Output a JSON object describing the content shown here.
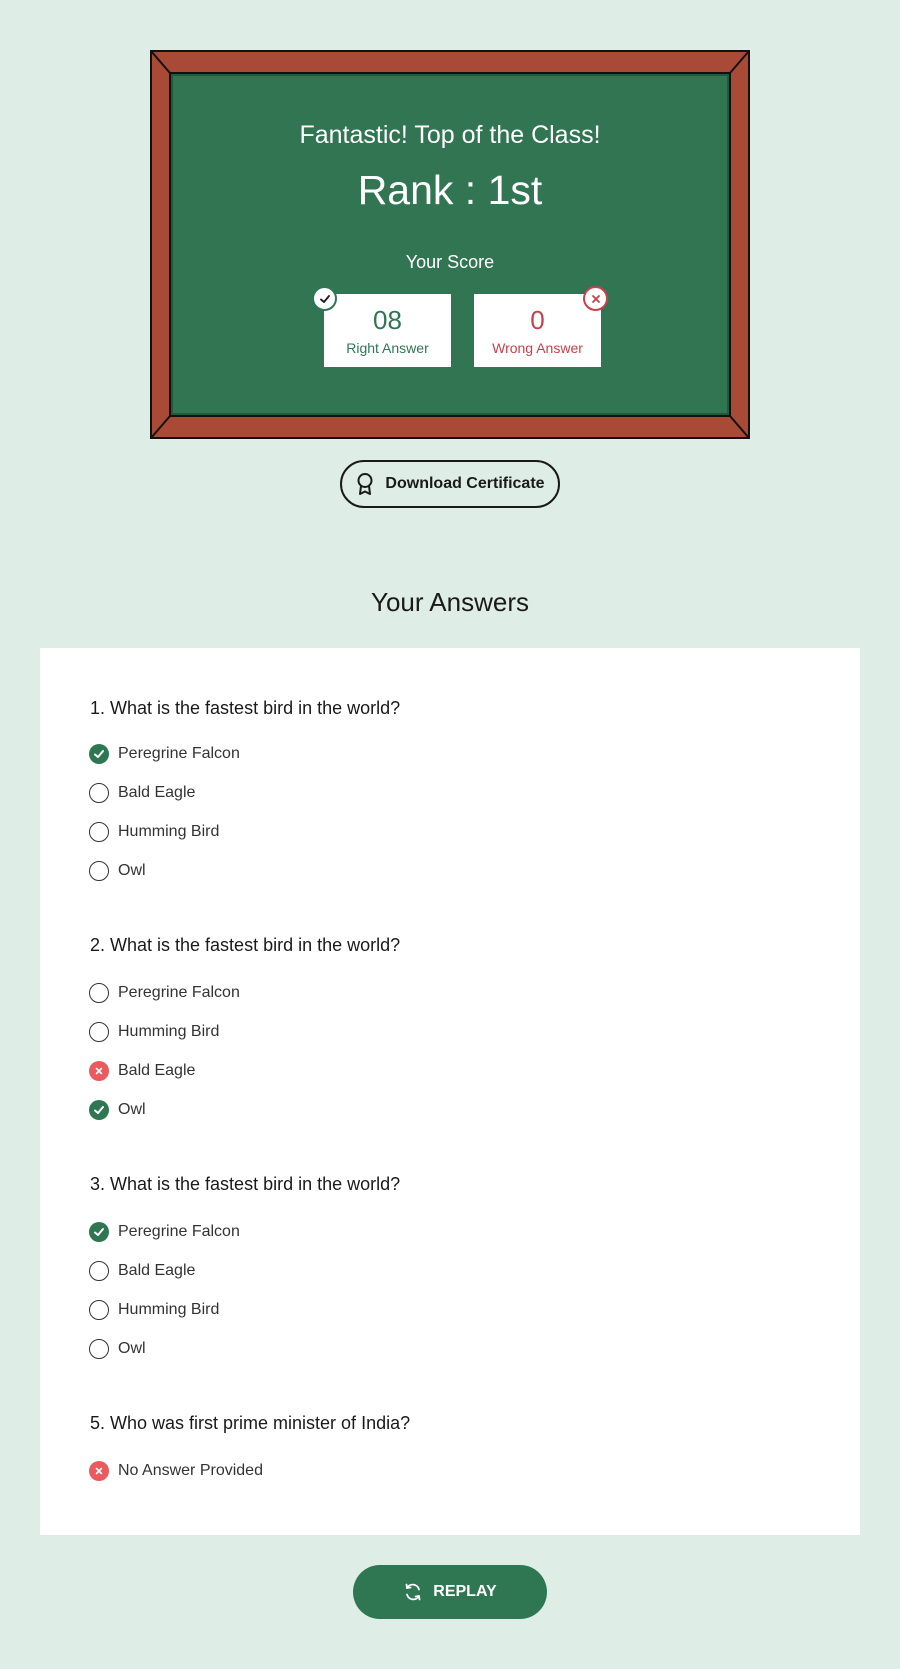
{
  "board": {
    "headline": "Fantastic! Top of the Class!",
    "rank": "Rank : 1st",
    "score_label": "Your Score",
    "right_count": "08",
    "right_label": "Right Answer",
    "wrong_count": "0",
    "wrong_label": "Wrong Answer"
  },
  "certificate": {
    "label": "Download Certificate",
    "icon": "award-ribbon-icon"
  },
  "answers": {
    "title": "Your Answers",
    "questions": [
      {
        "text": "1. What is the fastest bird in the world?",
        "options": [
          {
            "label": "Peregrine Falcon",
            "state": "correct"
          },
          {
            "label": "Bald Eagle",
            "state": "none"
          },
          {
            "label": "Humming Bird",
            "state": "none"
          },
          {
            "label": "Owl",
            "state": "none"
          }
        ]
      },
      {
        "text": "2. What is the fastest bird in the world?",
        "options": [
          {
            "label": "Peregrine Falcon",
            "state": "none"
          },
          {
            "label": "Humming Bird",
            "state": "none"
          },
          {
            "label": "Bald Eagle",
            "state": "wrong"
          },
          {
            "label": "Owl",
            "state": "correct"
          }
        ]
      },
      {
        "text": "3. What is the fastest bird in the world?",
        "options": [
          {
            "label": "Peregrine Falcon",
            "state": "correct"
          },
          {
            "label": "Bald Eagle",
            "state": "none"
          },
          {
            "label": "Humming Bird",
            "state": "none"
          },
          {
            "label": "Owl",
            "state": "none"
          }
        ]
      },
      {
        "text": "5. Who was first prime minister of India?",
        "options": [
          {
            "label": "No Answer Provided",
            "state": "wrong"
          }
        ]
      }
    ]
  },
  "replay": {
    "label": "REPLAY",
    "icon": "refresh-icon"
  },
  "colors": {
    "background": "#deede6",
    "board_green": "#327553",
    "frame_brown": "#a94a36",
    "correct": "#2f7653",
    "wrong": "#eb5a5e"
  }
}
